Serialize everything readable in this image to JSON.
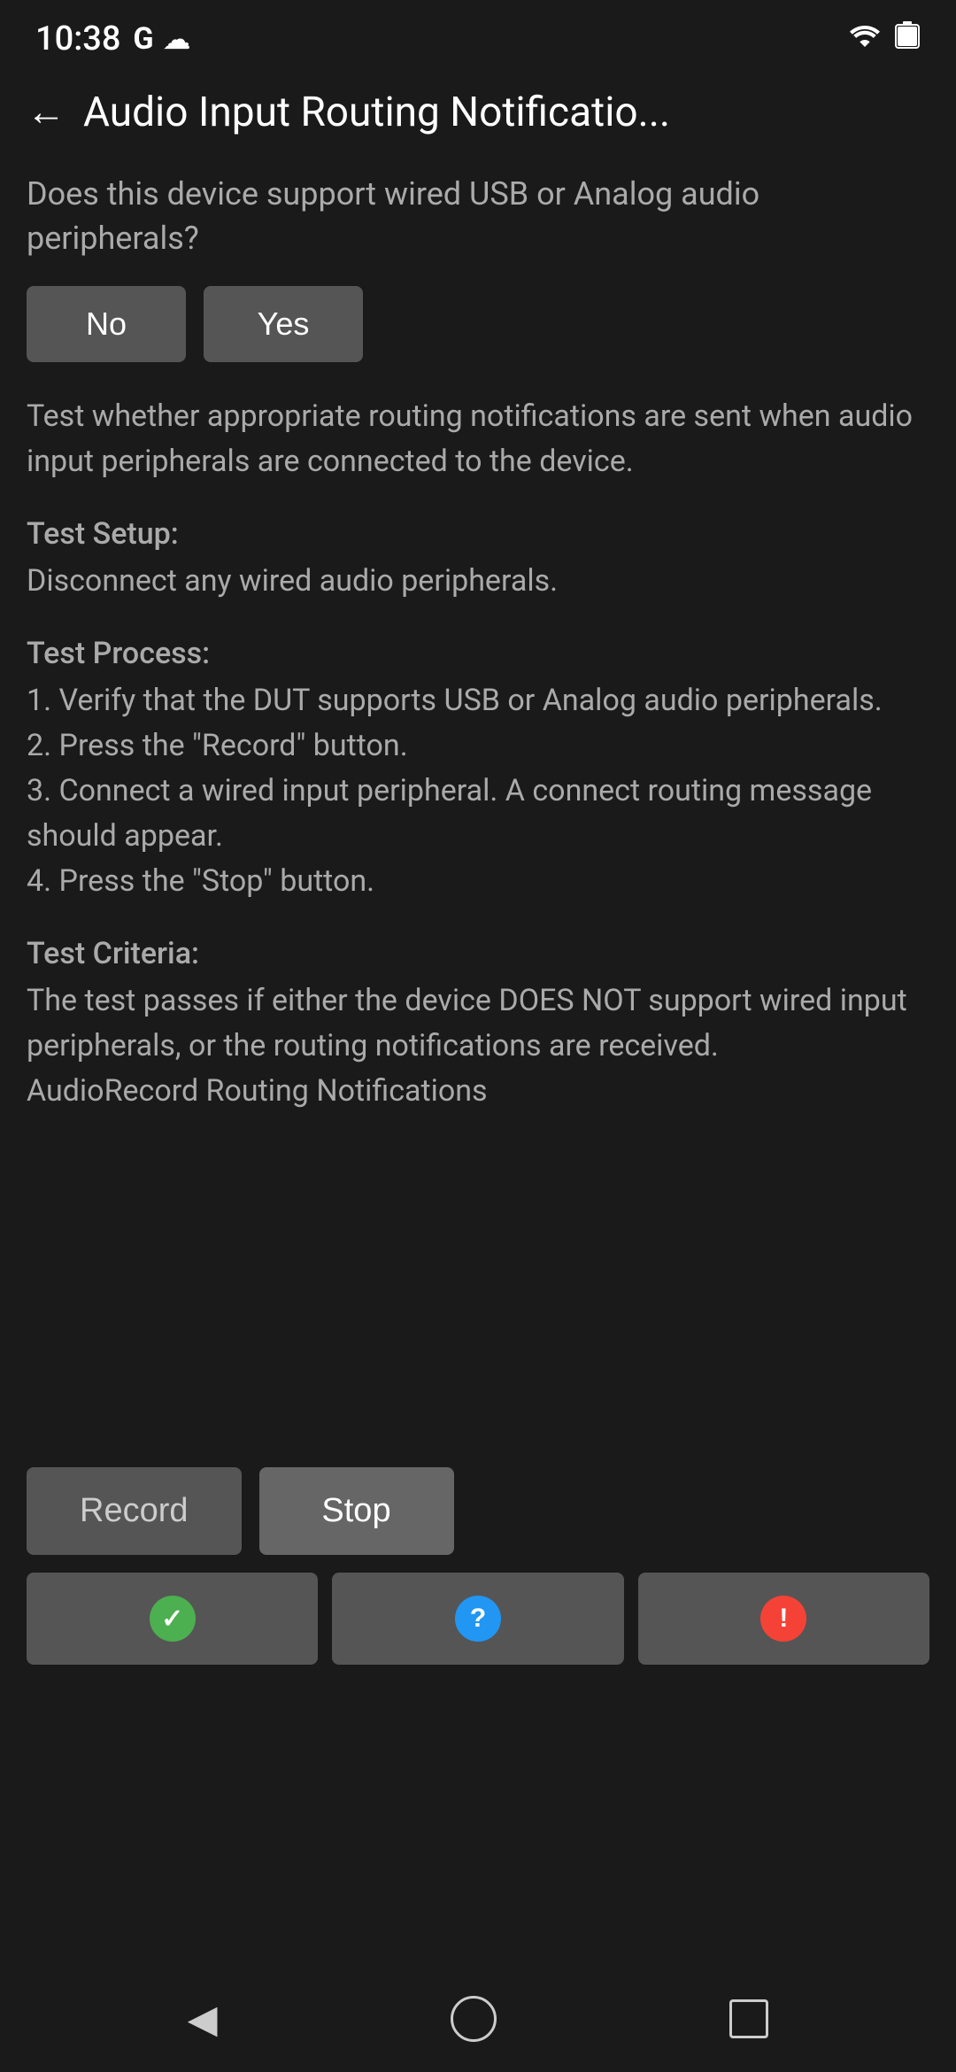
{
  "statusBar": {
    "time": "10:38",
    "googleLabel": "G",
    "cloudLabel": "☁"
  },
  "header": {
    "backLabel": "←",
    "title": "Audio Input Routing Notificatio..."
  },
  "content": {
    "question": "Does this device support wired USB or Analog audio peripherals?",
    "noLabel": "No",
    "yesLabel": "Yes",
    "description": "Test whether appropriate routing notifications are sent when audio input peripherals are connected to the device.",
    "testSetupTitle": "Test Setup:",
    "testSetupContent": "Disconnect any wired audio peripherals.",
    "testProcessTitle": "Test Process:",
    "testProcessContent": "1. Verify that the DUT supports USB or Analog audio peripherals.\n2. Press the \"Record\" button.\n3. Connect a wired input peripheral. A connect routing message should appear.\n4. Press the \"Stop\" button.",
    "testCriteriaTitle": "Test Criteria:",
    "testCriteriaContent": "The test passes if either the device DOES NOT support wired input peripherals, or the routing notifications are received.\nAudioRecord Routing Notifications"
  },
  "actions": {
    "recordLabel": "Record",
    "stopLabel": "Stop"
  },
  "results": {
    "passIconSymbol": "✓",
    "infoIconSymbol": "?",
    "failIconSymbol": "!"
  },
  "navBar": {
    "backLabel": "◀",
    "homeLabel": "",
    "recentsLabel": ""
  }
}
